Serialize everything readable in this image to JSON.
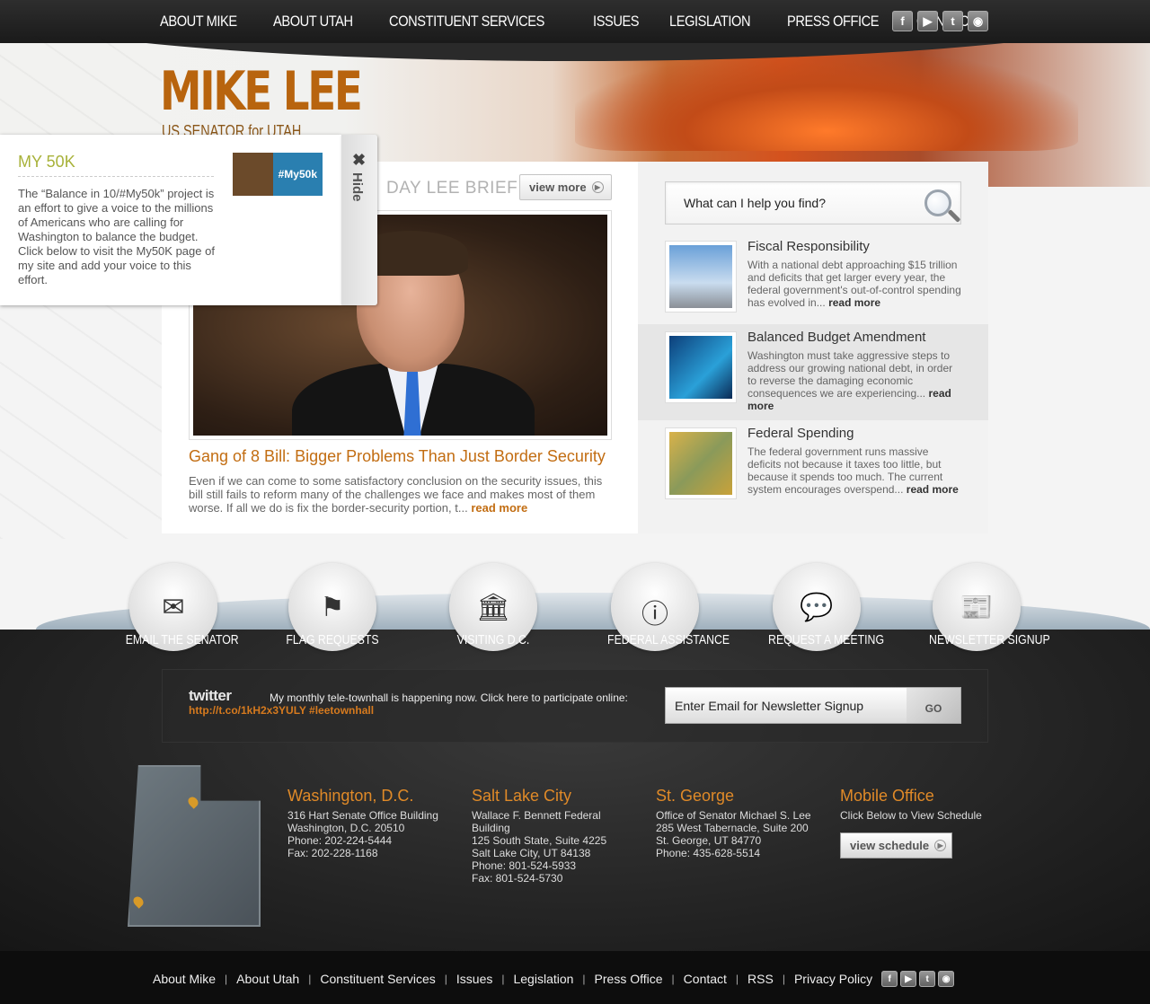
{
  "nav": {
    "items": [
      "ABOUT MIKE",
      "ABOUT UTAH",
      "CONSTITUENT SERVICES",
      "ISSUES",
      "LEGISLATION",
      "PRESS OFFICE",
      "CONTACT"
    ],
    "social_icons": [
      "facebook-icon",
      "youtube-icon",
      "twitter-icon",
      "rss-icon"
    ]
  },
  "logo": {
    "name": "MIKE LEE",
    "subtitle": "US SENATOR for UTAH"
  },
  "flyout": {
    "title": "MY 50K",
    "body": "The “Balance in 10/#My50k” project is an effort to give a voice to the millions of Americans who are calling for Washington to balance the budget. Click below to visit the My50K page of my site and add your voice to this effort.",
    "thumb_label": "#My50k",
    "hide_label": "Hide"
  },
  "feature": {
    "section_label": "DAY LEE BRIEFIN",
    "view_more": "view more",
    "headline": "Gang of 8 Bill: Bigger Problems Than Just Border Security",
    "excerpt": "Even if we can come to some satisfactory conclusion on the security issues, this bill still fails to reform many of the challenges we face and makes most of them worse. If all we do is fix the border-security portion, t...",
    "read_more": "read more"
  },
  "search": {
    "placeholder": "What can I help you find?"
  },
  "issues": [
    {
      "title": "Fiscal Responsibility",
      "text": "With a national debt approaching $15 trillion and deficits that get larger every year, the federal government's out-of-control spending has evolved in...",
      "read_more": "read more"
    },
    {
      "title": "Balanced Budget Amendment",
      "text": "Washington must take aggressive steps to address our growing national debt, in order to reverse the damaging economic consequences we are experiencing...",
      "read_more": "read more"
    },
    {
      "title": "Federal Spending",
      "text": "The federal government runs massive deficits not because it taxes too little, but because it spends too much. The current system encourages overspend...",
      "read_more": "read more"
    }
  ],
  "shortcuts": [
    {
      "label": "EMAIL THE SENATOR",
      "icon": "envelope-icon"
    },
    {
      "label": "FLAG REQUESTS",
      "icon": "flag-icon"
    },
    {
      "label": "VISITING D.C.",
      "icon": "capitol-icon"
    },
    {
      "label": "FEDERAL ASSISTANCE",
      "icon": "info-icon"
    },
    {
      "label": "REQUEST A MEETING",
      "icon": "speech-bubbles-icon"
    },
    {
      "label": "NEWSLETTER SIGNUP",
      "icon": "newspaper-icon"
    }
  ],
  "twitter": {
    "logo": "twitter",
    "text": "My monthly tele-townhall is happening now. Click here to participate online:",
    "link": "http://t.co/1kH2x3YULY #leetownhall"
  },
  "newsletter": {
    "placeholder": "Enter Email for Newsletter Signup",
    "go": "GO"
  },
  "offices": [
    {
      "title": "Washington, D.C.",
      "lines": [
        "316 Hart Senate Office Building",
        "Washington, D.C. 20510",
        "Phone: 202-224-5444",
        "Fax: 202-228-1168"
      ]
    },
    {
      "title": "Salt Lake City",
      "lines": [
        "Wallace F. Bennett Federal Building",
        "125 South State, Suite 4225",
        "Salt Lake City, UT 84138",
        "Phone: 801-524-5933",
        "Fax: 801-524-5730"
      ]
    },
    {
      "title": "St. George",
      "lines": [
        "Office of Senator Michael S. Lee",
        "285 West Tabernacle, Suite 200",
        "St. George, UT  84770",
        "Phone: 435-628-5514"
      ]
    },
    {
      "title": "Mobile Office",
      "lines": [
        "Click Below to View Schedule"
      ],
      "button": "view schedule"
    }
  ],
  "footer": {
    "links": [
      "About Mike",
      "About Utah",
      "Constituent Services",
      "Issues",
      "Legislation",
      "Press Office",
      "Contact",
      "RSS",
      "Privacy Policy"
    ]
  },
  "colors": {
    "accent_orange": "#c26d12",
    "office_title": "#e08a28",
    "my50k_green": "#a8b23a"
  }
}
